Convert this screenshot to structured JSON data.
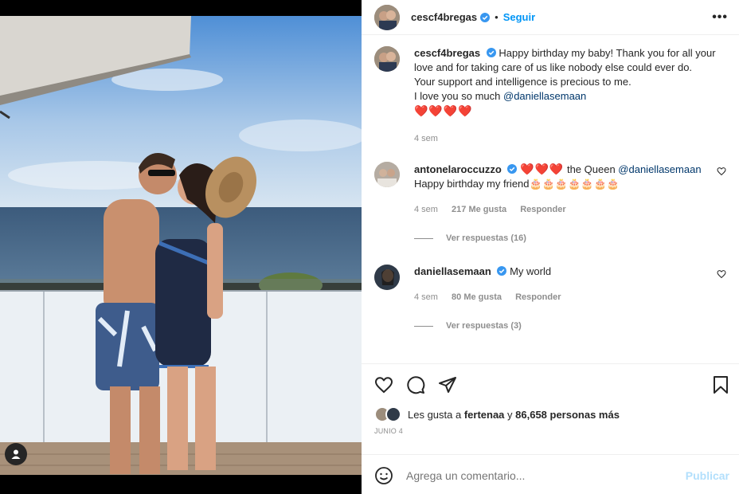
{
  "post": {
    "author": "cescf4bregas",
    "follow_label": "Seguir",
    "dot": "•",
    "more_label": "•••"
  },
  "caption": {
    "author": "cescf4bregas",
    "line1": "Happy birthday my baby! Thank you for all your love and for taking care of us like nobody else could ever do.",
    "line2": "Your support and intelligence is precious to me.",
    "line3_prefix": "I love you so much ",
    "mention": "@daniellasemaan",
    "hearts": "❤️❤️❤️❤️",
    "time": "4 sem"
  },
  "comments": [
    {
      "author": "antonelaroccuzzo",
      "hearts": "❤️❤️❤️",
      "text_prefix": " the Queen ",
      "mention": "@daniellasemaan",
      "text_line2": "Happy birthday my friend🎂🎂🎂🎂🎂🎂🎂",
      "time": "4 sem",
      "likes": "217 Me gusta",
      "reply_label": "Responder",
      "view_replies": "Ver respuestas (16)"
    },
    {
      "author": "daniellasemaan",
      "text": "My world",
      "time": "4 sem",
      "likes": "80 Me gusta",
      "reply_label": "Responder",
      "view_replies": "Ver respuestas (3)"
    }
  ],
  "likes_summary": {
    "prefix": "Les gusta a ",
    "user": "fertenaa",
    "middle": " y ",
    "count": "86,658 personas más"
  },
  "date": "JUNIO 4",
  "comment_box": {
    "placeholder": "Agrega un comentario...",
    "publish_label": "Publicar"
  },
  "colors": {
    "accent": "#0095f6",
    "verified": "#3897f0",
    "heart_red": "#ed1c24"
  },
  "icons": [
    "user-tag-icon",
    "verified-icon",
    "more-icon",
    "heart-icon",
    "comment-icon",
    "share-icon",
    "bookmark-icon",
    "emoji-icon"
  ]
}
